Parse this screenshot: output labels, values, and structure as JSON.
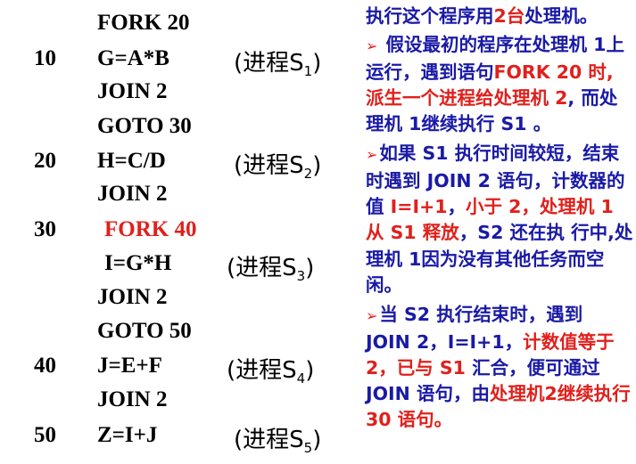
{
  "code": {
    "lines": [
      {
        "num": "",
        "stmt": "FORK 20",
        "proc": "",
        "sub": ""
      },
      {
        "num": "10",
        "stmt": "G=A*B",
        "proc": "(进程S",
        "sub": "1",
        "close": ")"
      },
      {
        "num": "",
        "stmt": "JOIN 2",
        "proc": "",
        "sub": ""
      },
      {
        "num": "",
        "stmt": "GOTO 30",
        "proc": "",
        "sub": ""
      },
      {
        "num": "20",
        "stmt": "H=C/D",
        "proc": "(进程S",
        "sub": "2",
        "close": ")"
      },
      {
        "num": "",
        "stmt": "JOIN 2",
        "proc": "",
        "sub": ""
      },
      {
        "num": "30",
        "stmt": "FORK 40",
        "proc": "",
        "sub": ""
      },
      {
        "num": "",
        "stmt": "I=G*H",
        "proc": "(进程S",
        "sub": "3",
        "close": ")"
      },
      {
        "num": "",
        "stmt": "JOIN 2",
        "proc": "",
        "sub": ""
      },
      {
        "num": "",
        "stmt": "GOTO 50",
        "proc": "",
        "sub": ""
      },
      {
        "num": "40",
        "stmt": "J=E+F",
        "proc": "(进程S",
        "sub": "4",
        "close": ")"
      },
      {
        "num": "",
        "stmt": "JOIN 2",
        "proc": "",
        "sub": ""
      },
      {
        "num": "50",
        "stmt": "Z=I+J",
        "proc": "(进程S",
        "sub": "5",
        "close": ")"
      }
    ]
  },
  "notes": {
    "intro_a": "执行这个程序用",
    "intro_b": "2台",
    "intro_c": "处理机。",
    "bullet": "➢",
    "p1_a": " 假设最初的程序在处理机 1上运行，遇到语句",
    "p1_b": "FORK 20 时, 派生一个进程给处理机 2",
    "p1_c": ", 而处理机 1继续执行 S1 。",
    "p2_a": "如果 S1 执行时间较短，结束时遇到 JOIN 2 语句，计数器的值 ",
    "p2_b": "I=I+1",
    "p2_c": "，",
    "p2_d": "小于 2，处理机 1 从 S1 释放",
    "p2_e": "，S2 还在执 行中,处理机 1因为没有其他任务而空闲。",
    "p3_a": "当 S2 执行结束时，遇到 JOIN 2，I=I+1，",
    "p3_b": "计数值等于2，已与 S1",
    "p3_c": " 汇合，便可通过 JOIN 语句，由",
    "p3_d": "处理机2继续执行30 语句。"
  },
  "colors": {
    "text_blue": "#1a1aa6",
    "highlight_red": "#e0201c",
    "code_black": "#000000"
  }
}
